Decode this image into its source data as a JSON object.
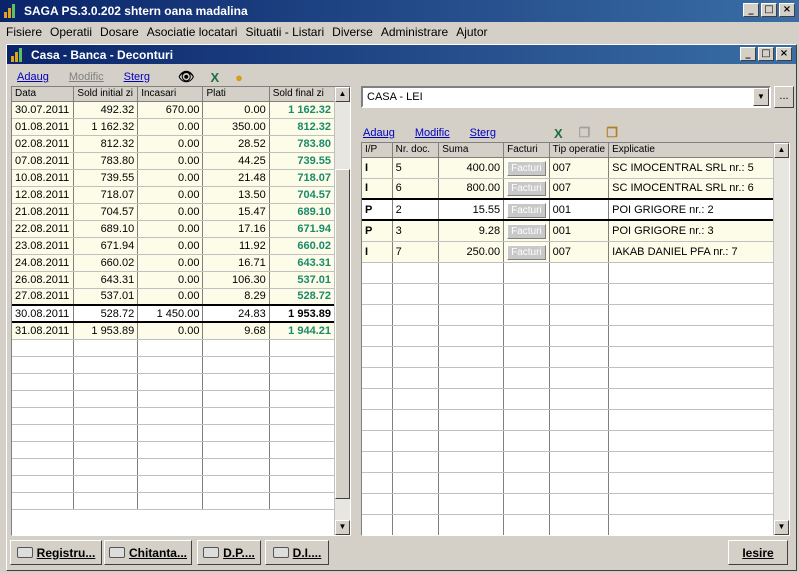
{
  "app": {
    "title": "SAGA PS.3.0.202   shtern oana madalina"
  },
  "menu": [
    "Fisiere",
    "Operatii",
    "Dosare",
    "Asociatie locatari",
    "Situatii - Listari",
    "Diverse",
    "Administrare",
    "Ajutor"
  ],
  "window": {
    "title": "Casa - Banca - Deconturi"
  },
  "left_toolbar": {
    "add": "Adaug",
    "modify": "Modific",
    "delete": "Sterg"
  },
  "left_table": {
    "headers": [
      "Data",
      "Sold initial zi",
      "Incasari",
      "Plati",
      "Sold final zi"
    ],
    "rows": [
      [
        "30.07.2011",
        "492.32",
        "670.00",
        "0.00",
        "1 162.32"
      ],
      [
        "01.08.2011",
        "1 162.32",
        "0.00",
        "350.00",
        "812.32"
      ],
      [
        "02.08.2011",
        "812.32",
        "0.00",
        "28.52",
        "783.80"
      ],
      [
        "07.08.2011",
        "783.80",
        "0.00",
        "44.25",
        "739.55"
      ],
      [
        "10.08.2011",
        "739.55",
        "0.00",
        "21.48",
        "718.07"
      ],
      [
        "12.08.2011",
        "718.07",
        "0.00",
        "13.50",
        "704.57"
      ],
      [
        "21.08.2011",
        "704.57",
        "0.00",
        "15.47",
        "689.10"
      ],
      [
        "22.08.2011",
        "689.10",
        "0.00",
        "17.16",
        "671.94"
      ],
      [
        "23.08.2011",
        "671.94",
        "0.00",
        "11.92",
        "660.02"
      ],
      [
        "24.08.2011",
        "660.02",
        "0.00",
        "16.71",
        "643.31"
      ],
      [
        "26.08.2011",
        "643.31",
        "0.00",
        "106.30",
        "537.01"
      ],
      [
        "27.08.2011",
        "537.01",
        "0.00",
        "8.29",
        "528.72"
      ],
      [
        "30.08.2011",
        "528.72",
        "1 450.00",
        "24.83",
        "1 953.89"
      ],
      [
        "31.08.2011",
        "1 953.89",
        "0.00",
        "9.68",
        "1 944.21"
      ]
    ],
    "selected_index": 12
  },
  "combo": {
    "value": "CASA - LEI",
    "ellipsis": "..."
  },
  "right_toolbar": {
    "add": "Adaug",
    "modify": "Modific",
    "delete": "Sterg"
  },
  "right_table": {
    "headers": [
      "I/P",
      "Nr. doc.",
      "Suma",
      "Facturi",
      "Tip operatie",
      "Explicatie"
    ],
    "facturi_label": "Facturi",
    "rows": [
      [
        "I",
        "5",
        "400.00",
        "007",
        "SC IMOCENTRAL SRL nr.: 5"
      ],
      [
        "I",
        "6",
        "800.00",
        "007",
        "SC IMOCENTRAL SRL nr.: 6"
      ],
      [
        "P",
        "2",
        "15.55",
        "001",
        "POI GRIGORE nr.: 2"
      ],
      [
        "P",
        "3",
        "9.28",
        "001",
        "POI GRIGORE nr.: 3"
      ],
      [
        "I",
        "7",
        "250.00",
        "007",
        "IAKAB DANIEL PFA nr.: 7"
      ]
    ],
    "selected_index": 2
  },
  "bottom_buttons": {
    "registru": "Registru...",
    "chitanta": "Chitanta...",
    "dp": "D.P....",
    "di": "D.I....",
    "exit": "Iesire"
  },
  "colors": {
    "title_bar": "#0a246a",
    "sold_final_text": "#1a8a6a",
    "link_text": "#0000c0"
  }
}
